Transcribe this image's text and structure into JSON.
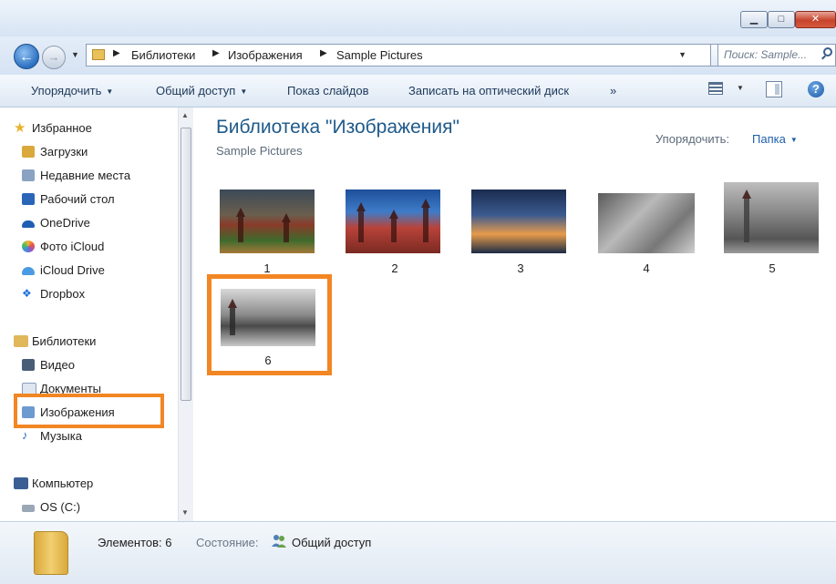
{
  "address": {
    "crumbs": [
      "Библиотеки",
      "Изображения",
      "Sample Pictures"
    ],
    "search_placeholder": "Поиск: Sample..."
  },
  "toolbar": {
    "organize": "Упорядочить",
    "share": "Общий доступ",
    "slideshow": "Показ слайдов",
    "burn": "Записать на оптический диск",
    "more": "»"
  },
  "nav": {
    "favorites": {
      "label": "Избранное",
      "items": [
        "Загрузки",
        "Недавние места",
        "Рабочий стол",
        "OneDrive",
        "Фото iCloud",
        "iCloud Drive",
        "Dropbox"
      ]
    },
    "libraries": {
      "label": "Библиотеки",
      "items": [
        "Видео",
        "Документы",
        "Изображения",
        "Музыка"
      ]
    },
    "computer": {
      "label": "Компьютер",
      "items": [
        "OS (C:)"
      ]
    }
  },
  "content": {
    "title": "Библиотека \"Изображения\"",
    "subtitle": "Sample Pictures",
    "arrange_label": "Упорядочить:",
    "arrange_value": "Папка",
    "items": [
      "1",
      "2",
      "3",
      "4",
      "5",
      "6"
    ]
  },
  "status": {
    "items_count": "Элементов: 6",
    "state_label": "Состояние:",
    "state_value": "Общий доступ"
  },
  "colors": {
    "highlight": "#f28623",
    "title_blue": "#1e5a8a"
  }
}
